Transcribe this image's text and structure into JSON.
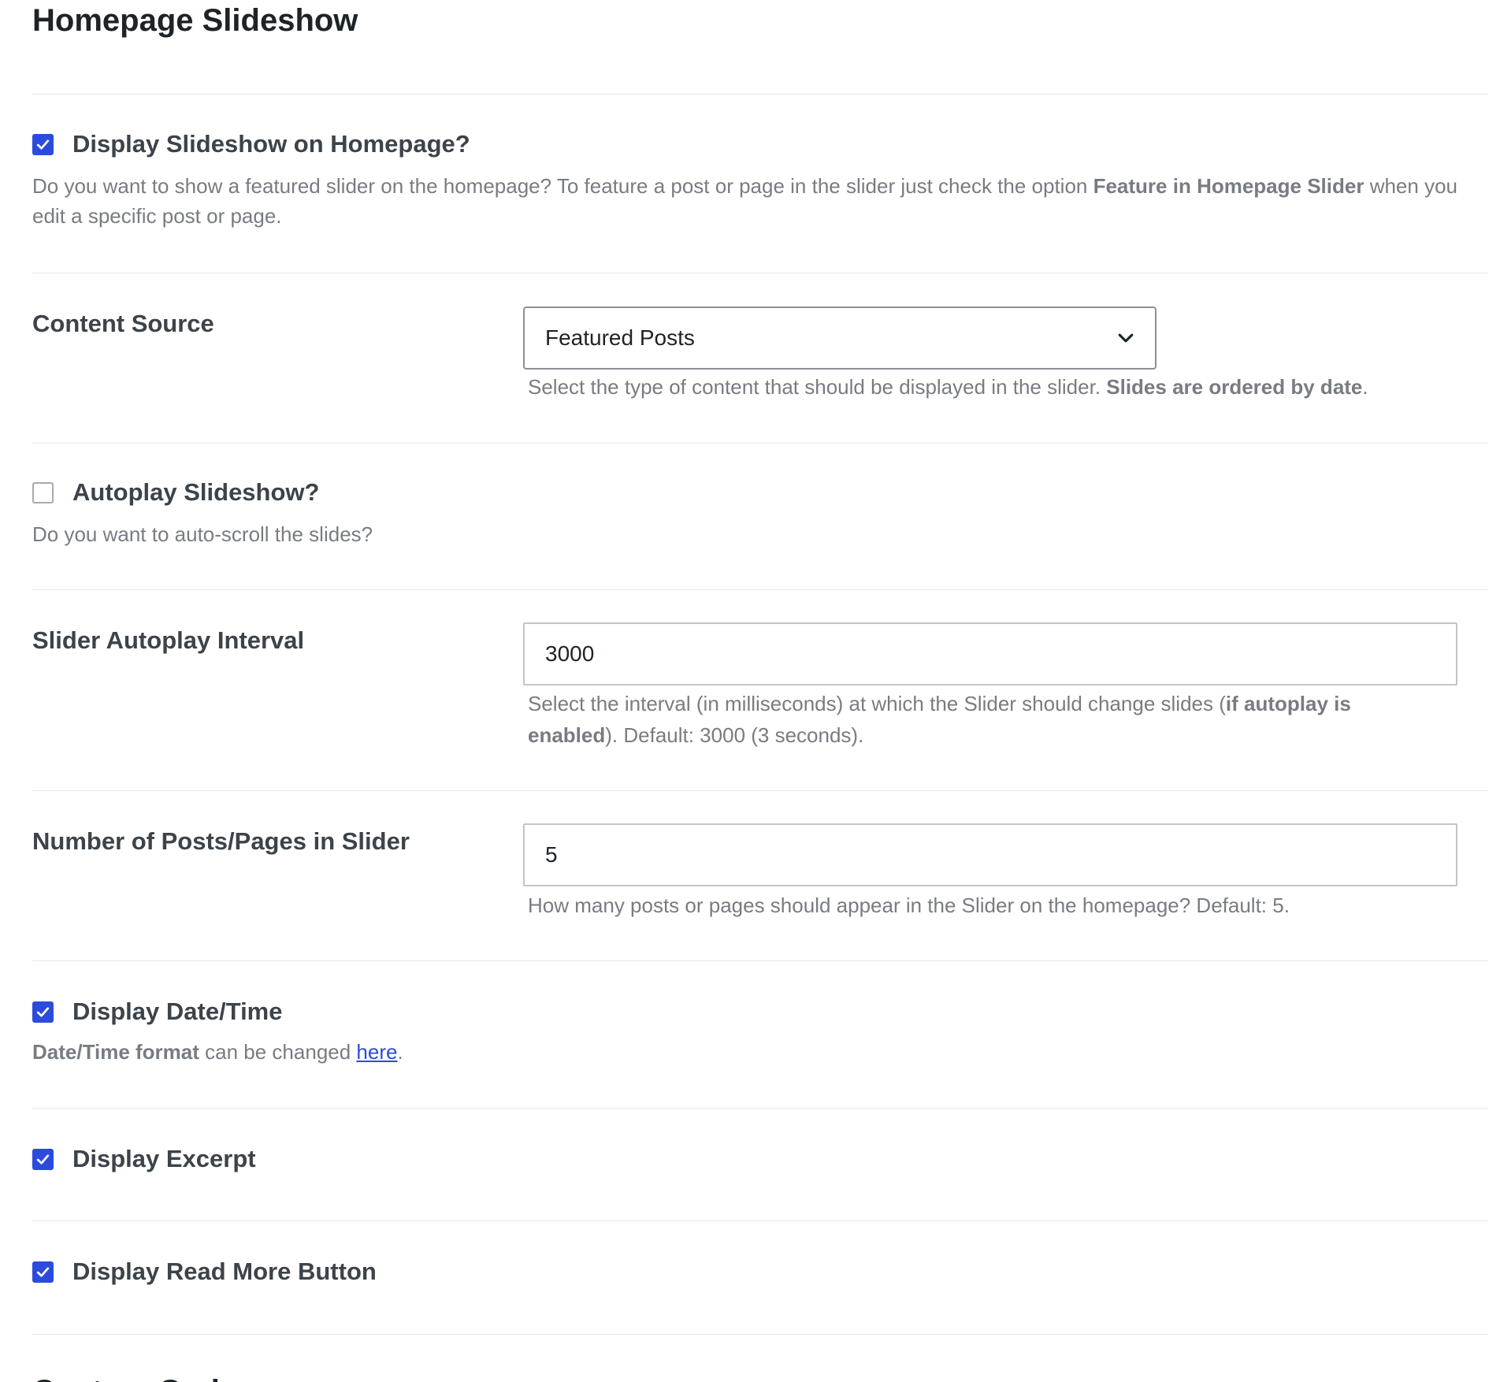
{
  "section_title": "Homepage Slideshow",
  "next_section_title": "Custom Code",
  "display_slideshow": {
    "checked": true,
    "label": "Display Slideshow on Homepage?",
    "desc_before": "Do you want to show a featured slider on the homepage? To feature a post or page in the slider just check the option ",
    "desc_bold": "Feature in Homepage Slider",
    "desc_after": " when you edit a specific post or page."
  },
  "content_source": {
    "label": "Content Source",
    "selected": "Featured Posts",
    "desc_before": "Select the type of content that should be displayed in the slider. ",
    "desc_bold": "Slides are ordered by date",
    "desc_after": "."
  },
  "autoplay": {
    "checked": false,
    "label": "Autoplay Slideshow?",
    "desc": "Do you want to auto-scroll the slides?"
  },
  "autoplay_interval": {
    "label": "Slider Autoplay Interval",
    "value": "3000",
    "desc_before": "Select the interval (in milliseconds) at which the Slider should change slides (",
    "desc_bold": "if autoplay is enabled",
    "desc_after": "). Default: 3000 (3 seconds)."
  },
  "num_posts": {
    "label": "Number of Posts/Pages in Slider",
    "value": "5",
    "desc": "How many posts or pages should appear in the Slider on the homepage? Default: 5."
  },
  "display_datetime": {
    "checked": true,
    "label": "Display Date/Time",
    "desc_bold": "Date/Time format",
    "desc_middle": " can be changed ",
    "desc_link": "here",
    "desc_after": "."
  },
  "display_excerpt": {
    "checked": true,
    "label": "Display Excerpt"
  },
  "display_read_more": {
    "checked": true,
    "label": "Display Read More Button"
  },
  "colors": {
    "accent": "#2b4bdd",
    "text": "#3c434a",
    "muted": "#787c82",
    "divider": "#e5e7ea"
  }
}
